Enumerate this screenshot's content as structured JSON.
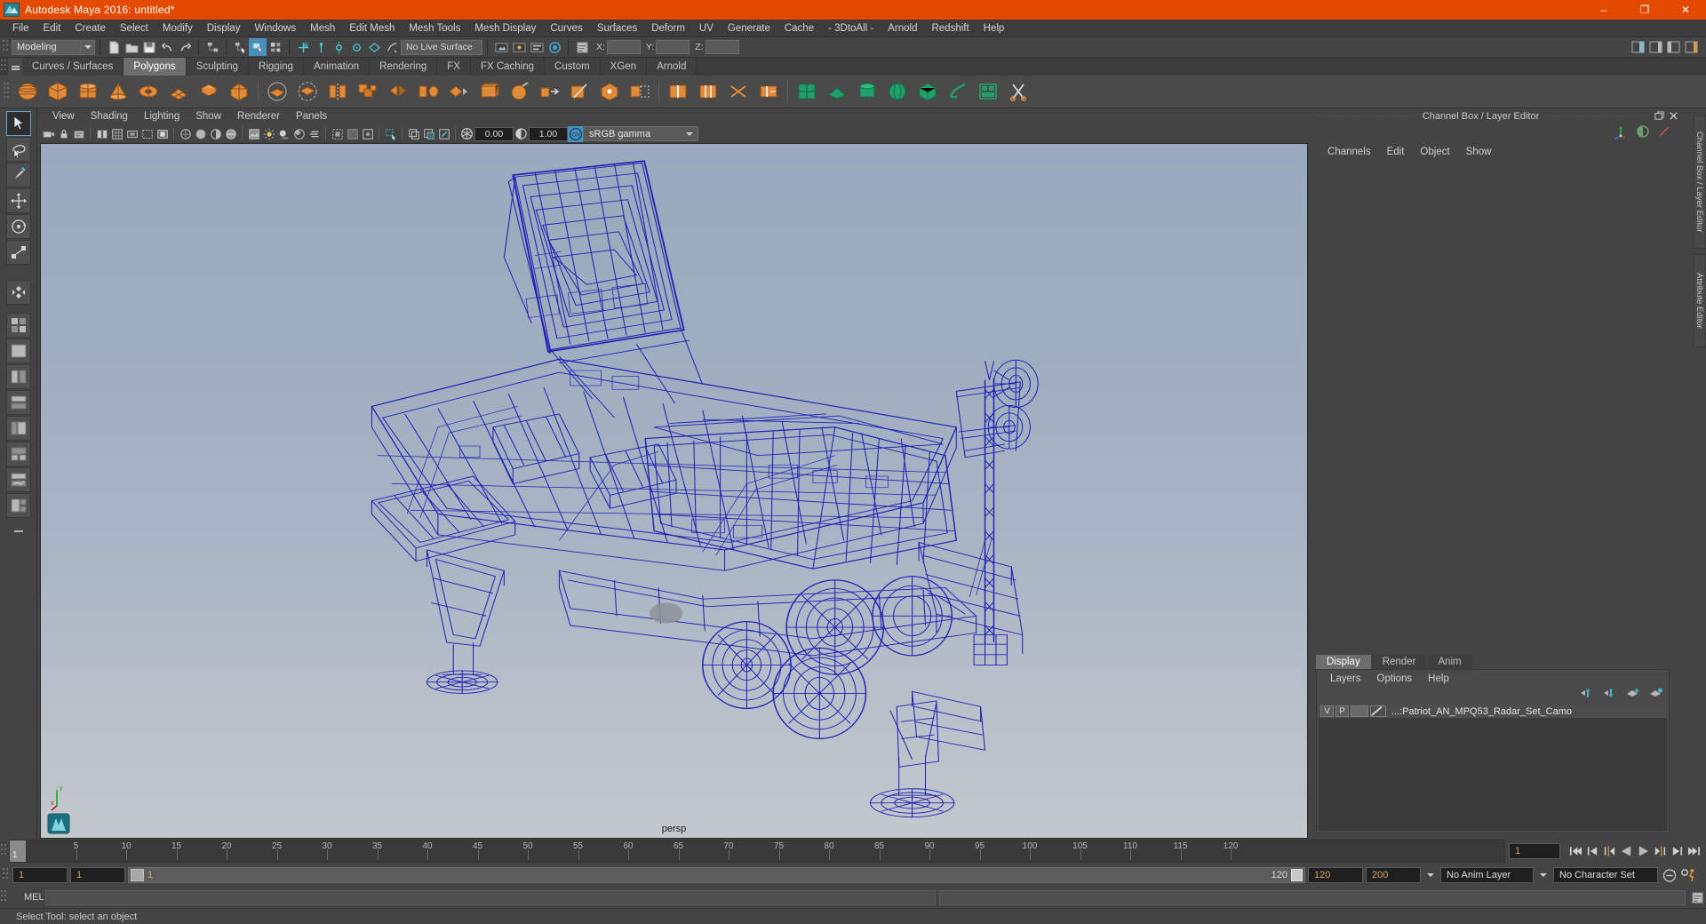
{
  "window": {
    "title": "Autodesk Maya 2016: untitled*",
    "minimize": "–",
    "maximize": "❐",
    "close": "✕",
    "titlebar_color": "#e44900"
  },
  "menubar": {
    "items": [
      "File",
      "Edit",
      "Create",
      "Select",
      "Modify",
      "Display",
      "Windows",
      "Mesh",
      "Edit Mesh",
      "Mesh Tools",
      "Mesh Display",
      "Curves",
      "Surfaces",
      "Deform",
      "UV",
      "Generate",
      "Cache",
      "- 3DtoAll -",
      "Arnold",
      "Redshift",
      "Help"
    ]
  },
  "statusline": {
    "menuset": "Modeling",
    "live_surface": "No Live Surface",
    "coord_labels": [
      "X:",
      "Y:",
      "Z:"
    ],
    "coord_values": [
      "",
      "",
      ""
    ]
  },
  "shelf": {
    "tabs": [
      "Curves / Surfaces",
      "Polygons",
      "Sculpting",
      "Rigging",
      "Animation",
      "Rendering",
      "FX",
      "FX Caching",
      "Custom",
      "XGen",
      "Arnold"
    ],
    "active_tab": "Polygons"
  },
  "viewport": {
    "menu": [
      "View",
      "Shading",
      "Lighting",
      "Show",
      "Renderer",
      "Panels"
    ],
    "camera_label": "persp",
    "exposure": "0.00",
    "gamma": "1.00",
    "color_management": "sRGB gamma",
    "color_management_toggle": "ON",
    "model_wireframe_color": "#1b1bb4",
    "bg_top": "#9aa9bd",
    "bg_bottom": "#c3c8cd"
  },
  "right_panel": {
    "title": "Channel Box / Layer Editor",
    "channel_menu": [
      "Channels",
      "Edit",
      "Object",
      "Show"
    ],
    "layer_tabs": [
      "Display",
      "Render",
      "Anim"
    ],
    "layer_active_tab": "Display",
    "layer_menu": [
      "Layers",
      "Options",
      "Help"
    ],
    "layers": [
      {
        "visible": "V",
        "playback": "P",
        "name": "...:Patriot_AN_MPQ53_Radar_Set_Camo"
      }
    ],
    "vertical_tabs": [
      "Channel Box / Layer Editor",
      "Attribute Editor"
    ]
  },
  "timeline": {
    "ticks": [
      "5",
      "10",
      "15",
      "20",
      "25",
      "30",
      "35",
      "40",
      "45",
      "50",
      "55",
      "60",
      "65",
      "70",
      "75",
      "80",
      "85",
      "90",
      "95",
      "100",
      "105",
      "110",
      "115",
      "120"
    ],
    "current_frame_marker": "1",
    "current_frame_field": "1",
    "playback_buttons": [
      "go-to-start",
      "step-back-key",
      "step-back-frame",
      "play-backwards",
      "play-forwards",
      "step-forward-frame",
      "step-forward-key",
      "go-to-end"
    ]
  },
  "range": {
    "start_field": "1",
    "anim_start_field": "1",
    "range_start_value": "1",
    "range_end_value": "120",
    "end_field": "120",
    "anim_end_field": "200",
    "anim_layer": "No Anim Layer",
    "character_set": "No Character Set"
  },
  "command_line": {
    "label": "MEL",
    "value": "",
    "placeholder": ""
  },
  "statusbar": {
    "help_text": "Select Tool: select an object"
  }
}
